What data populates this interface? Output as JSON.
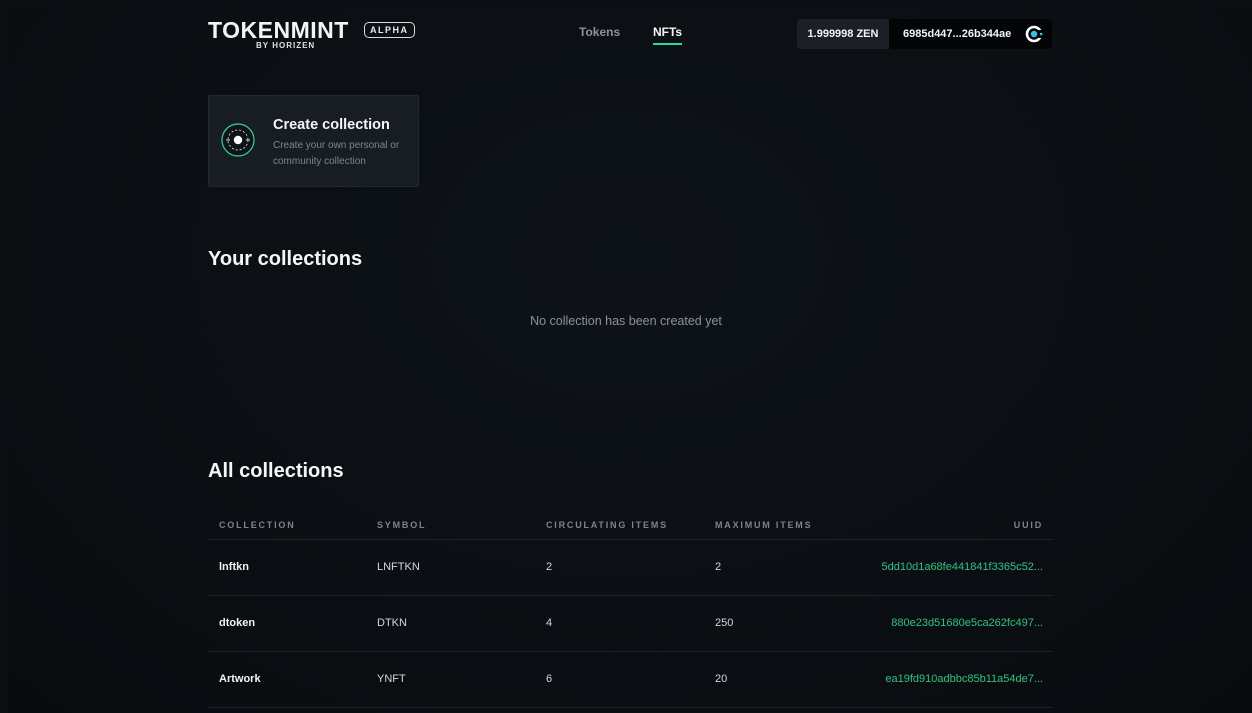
{
  "header": {
    "logo_main": "TOKENMINT",
    "logo_sub": "BY HORIZEN",
    "badge": "ALPHA",
    "nav": [
      {
        "label": "Tokens",
        "active": false
      },
      {
        "label": "NFTs",
        "active": true
      }
    ],
    "balance": "1.999998 ZEN",
    "wallet_address": "6985d447...26b344ae",
    "wallet_icon": "horizen-logo-icon"
  },
  "create_card": {
    "icon": "collection-target-icon",
    "title": "Create collection",
    "description": "Create your own personal or community collection"
  },
  "your_collections": {
    "heading": "Your collections",
    "empty_text": "No collection has been created yet"
  },
  "all_collections": {
    "heading": "All collections",
    "columns": [
      "COLLECTION",
      "SYMBOL",
      "CIRCULATING ITEMS",
      "MAXIMUM ITEMS",
      "UUID"
    ],
    "rows": [
      {
        "collection": "lnftkn",
        "symbol": "LNFTKN",
        "circulating": "2",
        "maximum": "2",
        "uuid": "5dd10d1a68fe441841f3365c52..."
      },
      {
        "collection": "dtoken",
        "symbol": "DTKN",
        "circulating": "4",
        "maximum": "250",
        "uuid": "880e23d51680e5ca262fc497..."
      },
      {
        "collection": "Artwork",
        "symbol": "YNFT",
        "circulating": "6",
        "maximum": "20",
        "uuid": "ea19fd910adbbc85b11a54de7..."
      }
    ]
  },
  "colors": {
    "accent": "#2fd69a",
    "uuid_text": "#27c482",
    "background": "#0b0e12",
    "card": "#181d23"
  }
}
